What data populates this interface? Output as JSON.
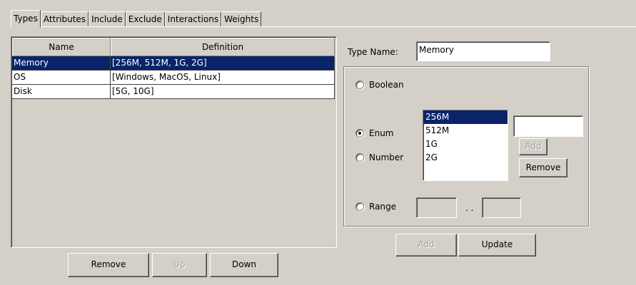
{
  "tabs": [
    "Types",
    "Attributes",
    "Include",
    "Exclude",
    "Interactions",
    "Weights"
  ],
  "table": {
    "headers": [
      "Name",
      "Definition"
    ],
    "rows": [
      {
        "name": "Memory",
        "definition": "[256M, 512M, 1G, 2G]"
      },
      {
        "name": "OS",
        "definition": "[Windows, MacOS, Linux]"
      },
      {
        "name": "Disk",
        "definition": "[5G, 10G]"
      }
    ]
  },
  "left_buttons": {
    "remove": "Remove",
    "up": "Up",
    "down": "Down"
  },
  "type_name": {
    "label": "Type Name:",
    "value": "Memory"
  },
  "radios": {
    "boolean": "Boolean",
    "enum": "Enum",
    "number": "Number",
    "range": "Range",
    "selected": "Enum"
  },
  "enum_values": [
    "256M",
    "512M",
    "1G",
    "2G"
  ],
  "enum_selected": "256M",
  "enum_input_value": "",
  "enum_buttons": {
    "add": "Add",
    "remove": "Remove"
  },
  "range": {
    "from": "",
    "to": "",
    "separator": ". ."
  },
  "bottom_buttons": {
    "add": "Add",
    "update": "Update"
  }
}
